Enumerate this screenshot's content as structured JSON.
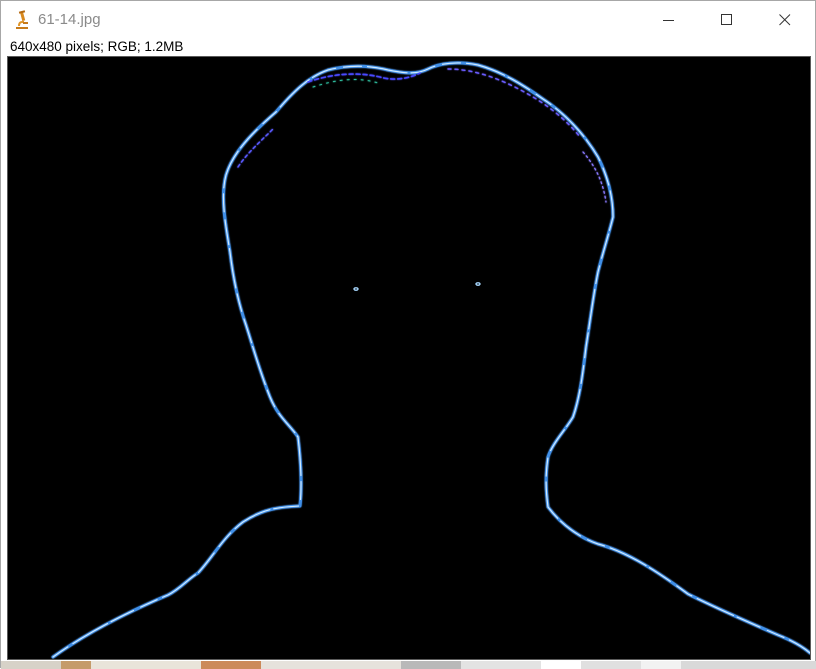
{
  "window": {
    "title": "61-14.jpg",
    "icon": "imagej-microscope-icon",
    "controls": {
      "minimize": "minimize-icon",
      "maximize": "maximize-icon",
      "close": "close-icon"
    }
  },
  "image_info": {
    "text": "640x480 pixels; RGB; 1.2MB"
  },
  "image": {
    "description_colors": {
      "background": "#000000",
      "edge": "#5ab8ff",
      "edge_highlight": "#e8f6ff",
      "edge_accent": "#3a3aff"
    }
  }
}
